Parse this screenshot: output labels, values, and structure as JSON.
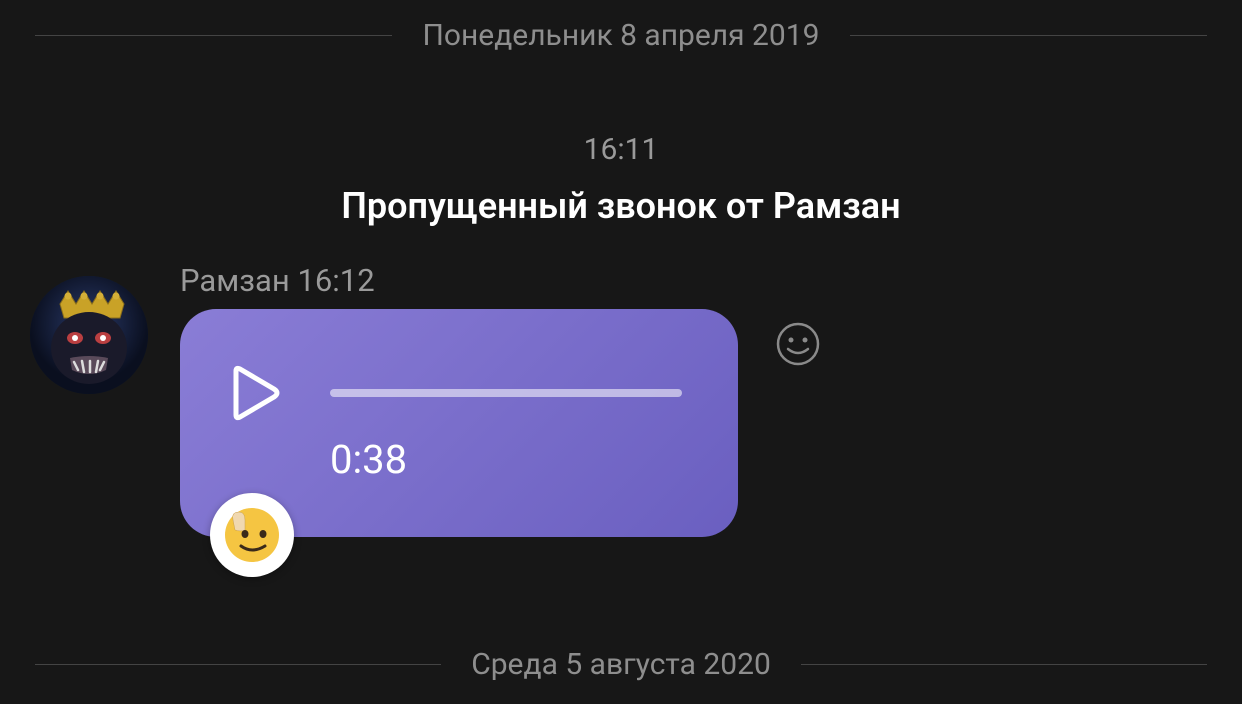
{
  "dates": {
    "top": "Понедельник 8 апреля 2019",
    "bottom": "Среда 5 августа 2020"
  },
  "missed_call": {
    "time": "16:11",
    "text": "Пропущенный звонок от Рамзан"
  },
  "message": {
    "sender": "Рамзан",
    "time": "16:12",
    "voice_duration": "0:38"
  }
}
